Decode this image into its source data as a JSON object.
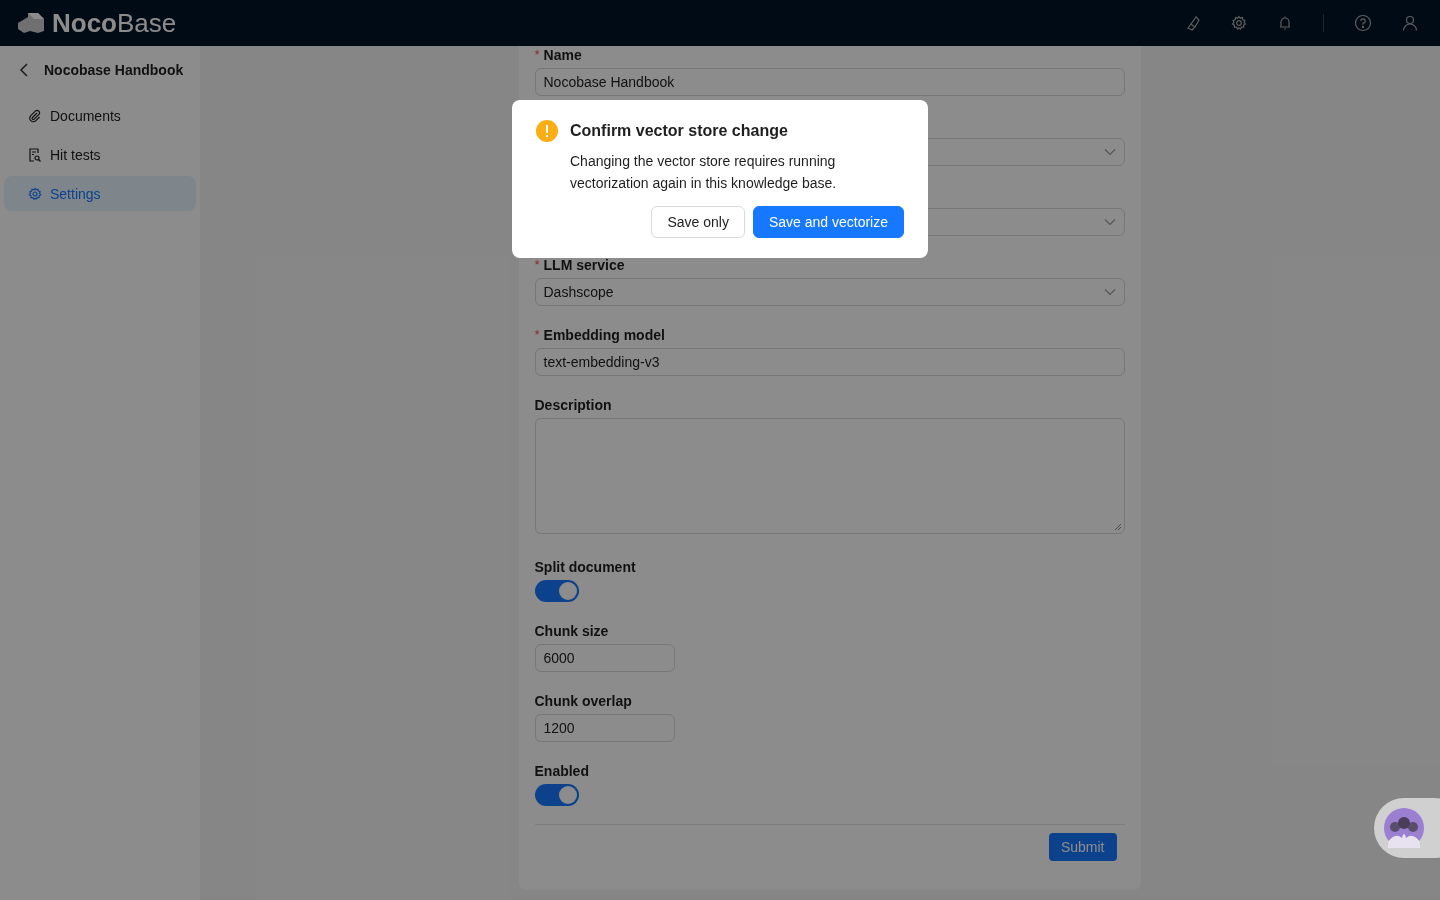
{
  "header": {
    "logo_bold": "Noco",
    "logo_light": "Base"
  },
  "sidebar": {
    "title": "Nocobase Handbook",
    "items": [
      {
        "label": "Documents",
        "selected": false
      },
      {
        "label": "Hit tests",
        "selected": false
      },
      {
        "label": "Settings",
        "selected": true
      }
    ]
  },
  "form": {
    "fields": [
      {
        "kind": "input",
        "label": "Name",
        "required_mark": "*",
        "value": "Nocobase Handbook"
      },
      {
        "kind": "select"
      },
      {
        "kind": "select"
      },
      {
        "kind": "select",
        "label": "LLM service",
        "required_mark": "*",
        "value": "Dashscope"
      },
      {
        "kind": "input",
        "label": "Embedding model",
        "required_mark": "*",
        "value": "text-embedding-v3"
      },
      {
        "kind": "textarea",
        "label": "Description"
      },
      {
        "kind": "switch",
        "label": "Split document",
        "on": true
      },
      {
        "kind": "short-input",
        "label": "Chunk size",
        "value": "6000"
      },
      {
        "kind": "short-input",
        "label": "Chunk overlap",
        "value": "1200"
      },
      {
        "kind": "switch",
        "label": "Enabled",
        "on": true
      }
    ],
    "submit": "Submit"
  },
  "dialog": {
    "title": "Confirm vector store change",
    "message": "Changing the vector store requires running vectorization again in this knowledge base.",
    "buttons": [
      {
        "label": "Save only",
        "primary": false
      },
      {
        "label": "Save and vectorize",
        "primary": true
      }
    ]
  }
}
